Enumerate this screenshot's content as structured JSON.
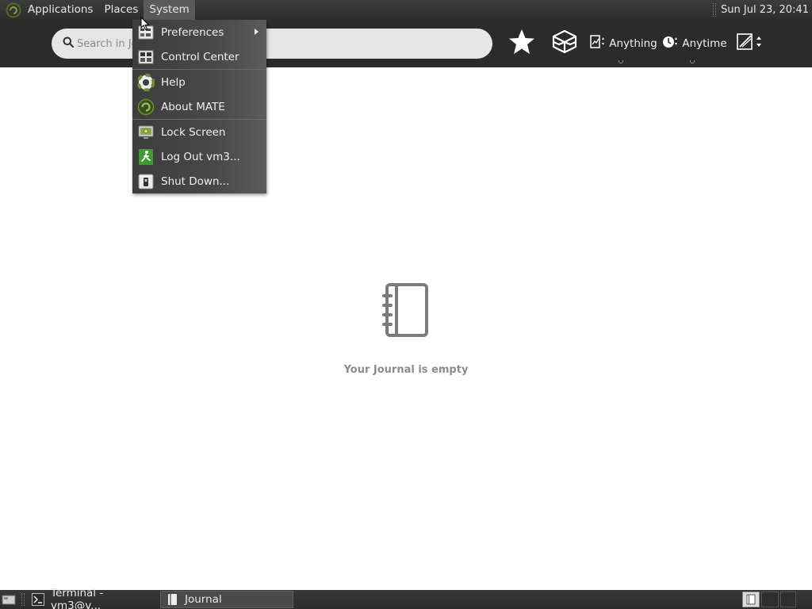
{
  "top_panel": {
    "menus": [
      "Applications",
      "Places",
      "System"
    ],
    "active_menu": "System",
    "clock": "Sun Jul 23, 20:41"
  },
  "journal_toolbar": {
    "search_placeholder": "Search in Journal",
    "filter_what": "Anything",
    "filter_when": "Anytime",
    "icons": [
      "star-icon",
      "dropbox-icon",
      "anything-filter-icon",
      "anytime-filter-icon",
      "sort-icon"
    ]
  },
  "system_menu": {
    "items": [
      {
        "label": "Preferences",
        "icon": "preferences-icon",
        "has_submenu": true
      },
      {
        "label": "Control Center",
        "icon": "control-center-icon"
      },
      {
        "label": "Help",
        "icon": "help-icon"
      },
      {
        "label": "About MATE",
        "icon": "mate-icon"
      },
      {
        "label": "Lock Screen",
        "icon": "lock-screen-icon"
      },
      {
        "label": "Log Out vm3...",
        "icon": "log-out-icon"
      },
      {
        "label": "Shut Down...",
        "icon": "shut-down-icon"
      }
    ]
  },
  "journal": {
    "empty_message": "Your Journal is empty",
    "empty_icon": "journal-notebook-icon"
  },
  "taskbar": {
    "tasks": [
      {
        "label": "Terminal - vm3@v...",
        "icon": "terminal-icon",
        "active": false
      },
      {
        "label": "Journal",
        "icon": "journal-icon",
        "active": true
      }
    ],
    "workspaces": 3,
    "active_workspace": 1
  },
  "colors": {
    "panel_bg": "#2e2e2e",
    "toolbar_bg": "#2b2b2b",
    "search_bg": "#e6e6e6",
    "menu_bg": "#444444",
    "empty_text": "#8c8c8c"
  }
}
